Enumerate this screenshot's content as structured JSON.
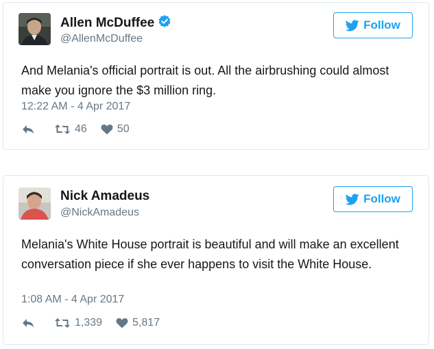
{
  "colors": {
    "accent": "#1da1f2",
    "secondary_text": "#657786",
    "border": "#e1e8ed"
  },
  "tweets": [
    {
      "name": "Allen McDuffee",
      "handle": "@AllenMcDuffee",
      "verified": true,
      "follow_label": "Follow",
      "text": "And Melania's official portrait is out. All the airbrushing could almost make you ignore the $3 million ring.",
      "timestamp": "12:22 AM - 4 Apr 2017",
      "retweets": "46",
      "likes": "50"
    },
    {
      "name": "Nick Amadeus",
      "handle": "@NickAmadeus",
      "verified": false,
      "follow_label": "Follow",
      "text": "Melania's White House portrait is beautiful and will make an excellent conversation piece if she ever happens to visit the White House.",
      "timestamp": "1:08 AM - 4 Apr 2017",
      "retweets": "1,339",
      "likes": "5,817"
    }
  ]
}
